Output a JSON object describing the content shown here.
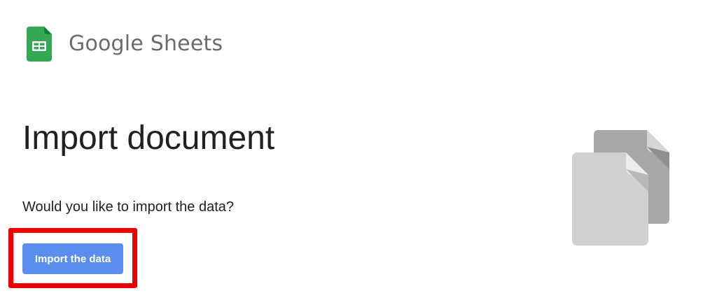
{
  "header": {
    "app_name": "Google Sheets",
    "logo_icon": "google-sheets-icon",
    "logo_color": "#34a853"
  },
  "main": {
    "title": "Import document",
    "prompt": "Would you like to import the data?",
    "import_button_label": "Import the data",
    "button_color": "#5b8def",
    "highlight_color": "#ee0000",
    "illustration_icon": "documents-icon"
  }
}
